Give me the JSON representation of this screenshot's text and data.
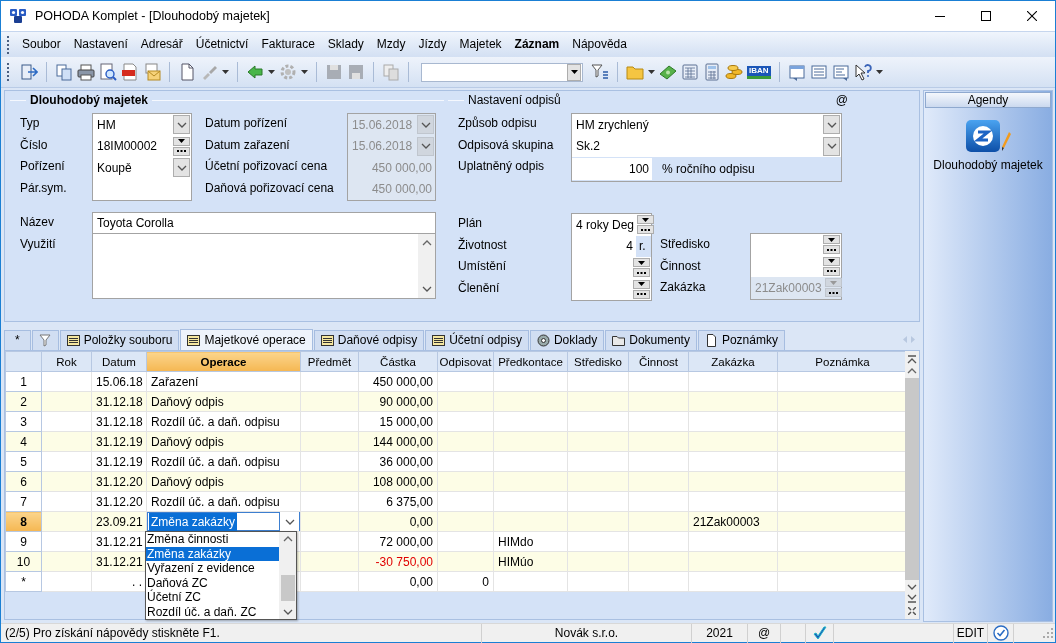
{
  "window": {
    "title": "POHODA Komplet - [Dlouhodobý majetek]"
  },
  "menu": [
    {
      "label": "Soubor",
      "bold": false
    },
    {
      "label": "Nastavení",
      "bold": false
    },
    {
      "label": "Adresář",
      "bold": false
    },
    {
      "label": "Účetnictví",
      "bold": false
    },
    {
      "label": "Fakturace",
      "bold": false
    },
    {
      "label": "Sklady",
      "bold": false
    },
    {
      "label": "Mzdy",
      "bold": false
    },
    {
      "label": "Jízdy",
      "bold": false
    },
    {
      "label": "Majetek",
      "bold": false
    },
    {
      "label": "Záznam",
      "bold": true
    },
    {
      "label": "Nápověda",
      "bold": false
    }
  ],
  "toolbar": {
    "iban_label": "IBAN"
  },
  "asset": {
    "title": "Dlouhodobý majetek",
    "fields": [
      {
        "label": "Typ",
        "value": "HM",
        "kind": "combo"
      },
      {
        "label": "Číslo",
        "value": "18IM00002",
        "kind": "picker"
      },
      {
        "label": "Pořízení",
        "value": "Koupě",
        "kind": "combo"
      },
      {
        "label": "Pár.sym.",
        "kind": "text"
      }
    ],
    "dates": [
      {
        "label": "Datum pořízení",
        "value": "15.06.2018",
        "kind": "combo",
        "disabled": true
      },
      {
        "label": "Datum zařazení",
        "value": "15.06.2018",
        "kind": "combo",
        "disabled": true
      },
      {
        "label": "Účetní pořizovací cena",
        "value": "450 000,00",
        "kind": "number",
        "disabled": true
      },
      {
        "label": "Daňová pořizovací cena",
        "value": "450 000,00",
        "kind": "number",
        "disabled": true
      }
    ],
    "name": {
      "label": "Název",
      "value": "Toyota Corolla"
    },
    "usage": {
      "label": "Využití"
    }
  },
  "depreciation": {
    "title": "Nastavení odpisů",
    "mark": "@",
    "method": [
      {
        "label": "Způsob odpisu",
        "value": "HM zrychlený",
        "kind": "combo"
      },
      {
        "label": "Odpisová skupina",
        "value": "Sk.2",
        "kind": "combo"
      }
    ],
    "applied": {
      "label": "Uplatněný odpis",
      "value": "100",
      "suffix": "% ročního odpisu"
    },
    "plan": [
      {
        "label": "Plán",
        "value": "4 roky Deg",
        "kind": "picker"
      },
      {
        "label": "Životnost",
        "value": "4",
        "unit": "r.",
        "kind": "number"
      },
      {
        "label": "Umístění",
        "kind": "picker"
      },
      {
        "label": "Členění",
        "kind": "picker"
      }
    ],
    "assignment": [
      {
        "label": "Středisko",
        "kind": "picker",
        "disabled": false
      },
      {
        "label": "Činnost",
        "kind": "picker",
        "disabled": false
      },
      {
        "label": "Zakázka",
        "value": "21Zak00003",
        "kind": "picker",
        "disabled": true
      }
    ]
  },
  "agendas": {
    "title": "Agendy",
    "items": [
      {
        "label": "Dlouhodobý majetek"
      }
    ]
  },
  "tabs": [
    {
      "label": "*",
      "kind": "plain",
      "selected": false
    },
    {
      "kind": "filter",
      "selected": false
    },
    {
      "label": "Položky souboru",
      "kind": "list",
      "selected": false
    },
    {
      "label": "Majetkové operace",
      "kind": "list",
      "selected": true
    },
    {
      "label": "Daňové odpisy",
      "kind": "list",
      "selected": false
    },
    {
      "label": "Účetní odpisy",
      "kind": "list",
      "selected": false
    },
    {
      "label": "Doklady",
      "kind": "disc",
      "selected": false
    },
    {
      "label": "Dokumenty",
      "kind": "folder",
      "selected": false
    },
    {
      "label": "Poznámky",
      "kind": "page",
      "selected": false
    }
  ],
  "table": {
    "columns": [
      {
        "label": "Rok",
        "selected": false
      },
      {
        "label": "Datum",
        "selected": false
      },
      {
        "label": "Operace",
        "selected": true
      },
      {
        "label": "Předmět",
        "selected": false
      },
      {
        "label": "Částka",
        "selected": false
      },
      {
        "label": "Odpisovat",
        "selected": false
      },
      {
        "label": "Předkontace",
        "selected": false
      },
      {
        "label": "Středisko",
        "selected": false
      },
      {
        "label": "Činnost",
        "selected": false
      },
      {
        "label": "Zakázka",
        "selected": false
      },
      {
        "label": "Poznámka",
        "selected": false
      }
    ],
    "rows": [
      {
        "number": "1",
        "current": false,
        "negative": false,
        "cells": [
          null,
          "15.06.18",
          "Zařazení",
          null,
          "450 000,00",
          null,
          null,
          null,
          null,
          null,
          null
        ]
      },
      {
        "number": "2",
        "current": false,
        "negative": false,
        "cells": [
          null,
          "31.12.18",
          "Daňový odpis",
          null,
          "90 000,00",
          null,
          null,
          null,
          null,
          null,
          null
        ]
      },
      {
        "number": "3",
        "current": false,
        "negative": false,
        "cells": [
          null,
          "31.12.18",
          "Rozdíl úč. a daň. odpisu",
          null,
          "15 000,00",
          null,
          null,
          null,
          null,
          null,
          null
        ]
      },
      {
        "number": "4",
        "current": false,
        "negative": false,
        "cells": [
          null,
          "31.12.19",
          "Daňový odpis",
          null,
          "144 000,00",
          null,
          null,
          null,
          null,
          null,
          null
        ]
      },
      {
        "number": "5",
        "current": false,
        "negative": false,
        "cells": [
          null,
          "31.12.19",
          "Rozdíl úč. a daň. odpisu",
          null,
          "36 000,00",
          null,
          null,
          null,
          null,
          null,
          null
        ]
      },
      {
        "number": "6",
        "current": false,
        "negative": false,
        "cells": [
          null,
          "31.12.20",
          "Daňový odpis",
          null,
          "108 000,00",
          null,
          null,
          null,
          null,
          null,
          null
        ]
      },
      {
        "number": "7",
        "current": false,
        "negative": false,
        "cells": [
          null,
          "31.12.20",
          "Rozdíl úč. a daň. odpisu",
          null,
          "6 375,00",
          null,
          null,
          null,
          null,
          null,
          null
        ]
      },
      {
        "number": "8",
        "current": true,
        "negative": false,
        "cells": [
          null,
          "23.09.21",
          "Změna zakázky",
          null,
          "0,00",
          null,
          null,
          null,
          null,
          "21Zak00003",
          null
        ]
      },
      {
        "number": "9",
        "current": false,
        "negative": false,
        "cells": [
          null,
          "31.12.21",
          null,
          null,
          "72 000,00",
          null,
          "HIMdo",
          null,
          null,
          null,
          null
        ]
      },
      {
        "number": "10",
        "current": false,
        "negative": true,
        "cells": [
          null,
          "31.12.21",
          null,
          null,
          "-30 750,00",
          null,
          "HIMúo",
          null,
          null,
          null,
          null
        ]
      },
      {
        "number": "*",
        "current": false,
        "negative": false,
        "cells": [
          null,
          ". .",
          null,
          null,
          "0,00",
          "0",
          null,
          null,
          null,
          null,
          null
        ]
      }
    ],
    "dropdown": {
      "items": [
        {
          "label": "Změna činnosti",
          "selected": false
        },
        {
          "label": "Změna zakázky",
          "selected": true
        },
        {
          "label": "Vyřazení z evidence",
          "selected": false
        },
        {
          "label": "Daňová ZC",
          "selected": false
        },
        {
          "label": "Účetní ZC",
          "selected": false
        },
        {
          "label": "Rozdíl úč. a daň. ZC",
          "selected": false
        }
      ]
    }
  },
  "status_bar": {
    "message": "(2/5) Pro získání nápovědy stiskněte F1.",
    "company": "Novák s.r.o.",
    "year": "2021",
    "mail": "@",
    "mode": "EDIT"
  }
}
